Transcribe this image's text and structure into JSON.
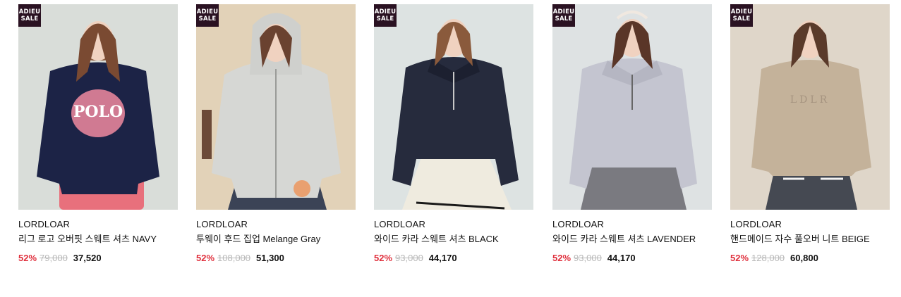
{
  "badge": {
    "line1": "ADIEU",
    "line2": "SALE"
  },
  "products": [
    {
      "brand": "LORDLOAR",
      "name": "리그 로고 오버핏 스웨트 셔츠 NAVY",
      "discount": "52%",
      "original_price": "79,000",
      "sale_price": "37,520",
      "bg_color": "#d9ddd9",
      "garment_color": "#1c2346",
      "bottom_color": "#e8707c"
    },
    {
      "brand": "LORDLOAR",
      "name": "투웨이 후드 집업 Melange Gray",
      "discount": "52%",
      "original_price": "108,000",
      "sale_price": "51,300",
      "bg_color": "#e2d2b8",
      "garment_color": "#d6d7d4",
      "bottom_color": "#3b4356"
    },
    {
      "brand": "LORDLOAR",
      "name": "와이드 카라 스웨트 셔츠 BLACK",
      "discount": "52%",
      "original_price": "93,000",
      "sale_price": "44,170",
      "bg_color": "#dde3e2",
      "garment_color": "#262b3d",
      "bottom_color": "#efebdf"
    },
    {
      "brand": "LORDLOAR",
      "name": "와이드 카라 스웨트 셔츠 LAVENDER",
      "discount": "52%",
      "original_price": "93,000",
      "sale_price": "44,170",
      "bg_color": "#dee2e3",
      "garment_color": "#c4c5d0",
      "bottom_color": "#7a7a80"
    },
    {
      "brand": "LORDLOAR",
      "name": "핸드메이드 자수 풀오버 니트 BEIGE",
      "discount": "52%",
      "original_price": "128,000",
      "sale_price": "60,800",
      "bg_color": "#dfd6c9",
      "garment_color": "#c4b29a",
      "bottom_color": "#454952"
    }
  ]
}
